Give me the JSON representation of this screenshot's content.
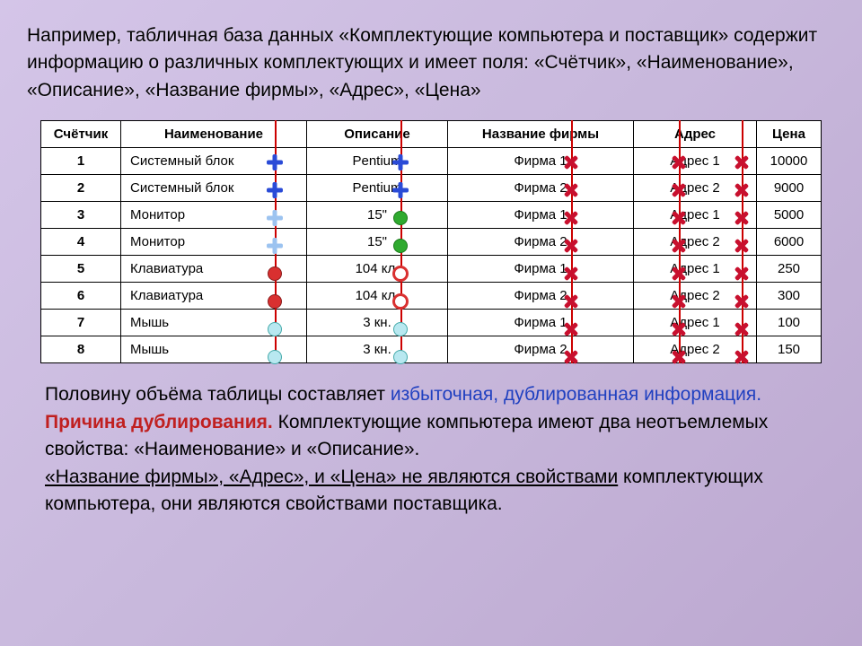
{
  "intro": "Например, табличная база данных «Комплектующие компьютера и поставщик» содержит информацию о различных комплектующих и имеет поля: «Счётчик», «Наименование», «Описание», «Название фирмы», «Адрес», «Цена»",
  "headers": {
    "counter": "Счётчик",
    "name": "Наименование",
    "desc": "Описание",
    "firm": "Название фирмы",
    "addr": "Адрес",
    "price": "Цена"
  },
  "rows": [
    {
      "n": "1",
      "name": "Системный блок",
      "desc": "Pentium",
      "firm": "Фирма 1",
      "addr": "Адрес 1",
      "price": "10000"
    },
    {
      "n": "2",
      "name": "Системный блок",
      "desc": "Pentium",
      "firm": "Фирма 2",
      "addr": "Адрес 2",
      "price": "9000"
    },
    {
      "n": "3",
      "name": "Монитор",
      "desc": "15\"",
      "firm": "Фирма 1",
      "addr": "Адрес 1",
      "price": "5000"
    },
    {
      "n": "4",
      "name": "Монитор",
      "desc": "15\"",
      "firm": "Фирма 2",
      "addr": "Адрес 2",
      "price": "6000"
    },
    {
      "n": "5",
      "name": "Клавиатура",
      "desc": "104 кл.",
      "firm": "Фирма 1",
      "addr": "Адрес 1",
      "price": "250"
    },
    {
      "n": "6",
      "name": "Клавиатура",
      "desc": "104 кл.",
      "firm": "Фирма 2",
      "addr": "Адрес 2",
      "price": "300"
    },
    {
      "n": "7",
      "name": "Мышь",
      "desc": "3 кн.",
      "firm": "Фирма 1",
      "addr": "Адрес 1",
      "price": "100"
    },
    {
      "n": "8",
      "name": "Мышь",
      "desc": "3 кн.",
      "firm": "Фирма 2",
      "addr": "Адрес 2",
      "price": "150"
    }
  ],
  "outro": {
    "p1a": "Половину объёма таблицы составляет ",
    "p1b": "избыточная, дублированная информация.",
    "p2a": "Причина дублирования.",
    "p2b": " Комплектующие компьютера имеют два неотъемлемых свойства: «Наименование» и «Описание».",
    "p3a": "«Название фирмы», «Адрес», и «Цена» не являются свойствами",
    "p3b": " комплектующих компьютера, они являются свойствами поставщика."
  }
}
